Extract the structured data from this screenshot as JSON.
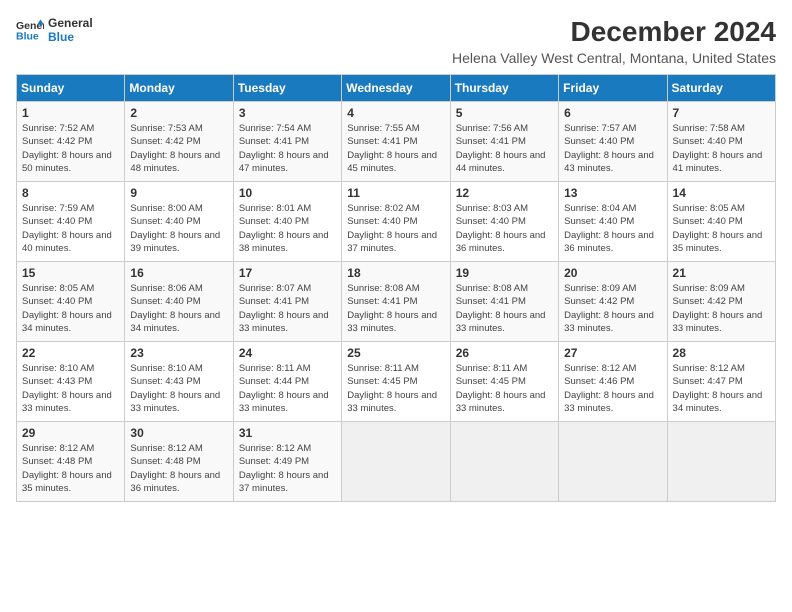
{
  "logo": {
    "line1": "General",
    "line2": "Blue"
  },
  "title": "December 2024",
  "subtitle": "Helena Valley West Central, Montana, United States",
  "days_of_week": [
    "Sunday",
    "Monday",
    "Tuesday",
    "Wednesday",
    "Thursday",
    "Friday",
    "Saturday"
  ],
  "weeks": [
    [
      {
        "day": 1,
        "sunrise": "7:52 AM",
        "sunset": "4:42 PM",
        "daylight": "8 hours and 50 minutes."
      },
      {
        "day": 2,
        "sunrise": "7:53 AM",
        "sunset": "4:42 PM",
        "daylight": "8 hours and 48 minutes."
      },
      {
        "day": 3,
        "sunrise": "7:54 AM",
        "sunset": "4:41 PM",
        "daylight": "8 hours and 47 minutes."
      },
      {
        "day": 4,
        "sunrise": "7:55 AM",
        "sunset": "4:41 PM",
        "daylight": "8 hours and 45 minutes."
      },
      {
        "day": 5,
        "sunrise": "7:56 AM",
        "sunset": "4:41 PM",
        "daylight": "8 hours and 44 minutes."
      },
      {
        "day": 6,
        "sunrise": "7:57 AM",
        "sunset": "4:40 PM",
        "daylight": "8 hours and 43 minutes."
      },
      {
        "day": 7,
        "sunrise": "7:58 AM",
        "sunset": "4:40 PM",
        "daylight": "8 hours and 41 minutes."
      }
    ],
    [
      {
        "day": 8,
        "sunrise": "7:59 AM",
        "sunset": "4:40 PM",
        "daylight": "8 hours and 40 minutes."
      },
      {
        "day": 9,
        "sunrise": "8:00 AM",
        "sunset": "4:40 PM",
        "daylight": "8 hours and 39 minutes."
      },
      {
        "day": 10,
        "sunrise": "8:01 AM",
        "sunset": "4:40 PM",
        "daylight": "8 hours and 38 minutes."
      },
      {
        "day": 11,
        "sunrise": "8:02 AM",
        "sunset": "4:40 PM",
        "daylight": "8 hours and 37 minutes."
      },
      {
        "day": 12,
        "sunrise": "8:03 AM",
        "sunset": "4:40 PM",
        "daylight": "8 hours and 36 minutes."
      },
      {
        "day": 13,
        "sunrise": "8:04 AM",
        "sunset": "4:40 PM",
        "daylight": "8 hours and 36 minutes."
      },
      {
        "day": 14,
        "sunrise": "8:05 AM",
        "sunset": "4:40 PM",
        "daylight": "8 hours and 35 minutes."
      }
    ],
    [
      {
        "day": 15,
        "sunrise": "8:05 AM",
        "sunset": "4:40 PM",
        "daylight": "8 hours and 34 minutes."
      },
      {
        "day": 16,
        "sunrise": "8:06 AM",
        "sunset": "4:40 PM",
        "daylight": "8 hours and 34 minutes."
      },
      {
        "day": 17,
        "sunrise": "8:07 AM",
        "sunset": "4:41 PM",
        "daylight": "8 hours and 33 minutes."
      },
      {
        "day": 18,
        "sunrise": "8:08 AM",
        "sunset": "4:41 PM",
        "daylight": "8 hours and 33 minutes."
      },
      {
        "day": 19,
        "sunrise": "8:08 AM",
        "sunset": "4:41 PM",
        "daylight": "8 hours and 33 minutes."
      },
      {
        "day": 20,
        "sunrise": "8:09 AM",
        "sunset": "4:42 PM",
        "daylight": "8 hours and 33 minutes."
      },
      {
        "day": 21,
        "sunrise": "8:09 AM",
        "sunset": "4:42 PM",
        "daylight": "8 hours and 33 minutes."
      }
    ],
    [
      {
        "day": 22,
        "sunrise": "8:10 AM",
        "sunset": "4:43 PM",
        "daylight": "8 hours and 33 minutes."
      },
      {
        "day": 23,
        "sunrise": "8:10 AM",
        "sunset": "4:43 PM",
        "daylight": "8 hours and 33 minutes."
      },
      {
        "day": 24,
        "sunrise": "8:11 AM",
        "sunset": "4:44 PM",
        "daylight": "8 hours and 33 minutes."
      },
      {
        "day": 25,
        "sunrise": "8:11 AM",
        "sunset": "4:45 PM",
        "daylight": "8 hours and 33 minutes."
      },
      {
        "day": 26,
        "sunrise": "8:11 AM",
        "sunset": "4:45 PM",
        "daylight": "8 hours and 33 minutes."
      },
      {
        "day": 27,
        "sunrise": "8:12 AM",
        "sunset": "4:46 PM",
        "daylight": "8 hours and 33 minutes."
      },
      {
        "day": 28,
        "sunrise": "8:12 AM",
        "sunset": "4:47 PM",
        "daylight": "8 hours and 34 minutes."
      }
    ],
    [
      {
        "day": 29,
        "sunrise": "8:12 AM",
        "sunset": "4:48 PM",
        "daylight": "8 hours and 35 minutes."
      },
      {
        "day": 30,
        "sunrise": "8:12 AM",
        "sunset": "4:48 PM",
        "daylight": "8 hours and 36 minutes."
      },
      {
        "day": 31,
        "sunrise": "8:12 AM",
        "sunset": "4:49 PM",
        "daylight": "8 hours and 37 minutes."
      },
      null,
      null,
      null,
      null
    ]
  ]
}
